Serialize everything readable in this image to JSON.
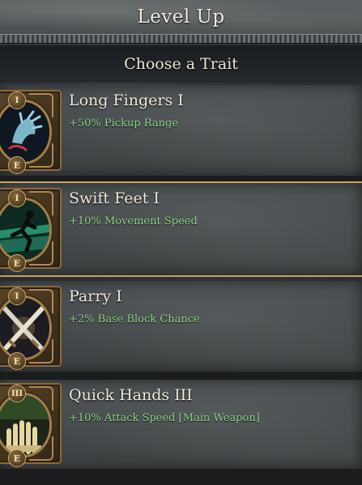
{
  "header": {
    "title": "Level Up"
  },
  "sub_header": {
    "title": "Choose a Trait"
  },
  "traits": [
    {
      "name": "Long Fingers I",
      "effect": "+50% Pickup Range",
      "rank": "I",
      "key": "E",
      "icon": "grabbing-hand-icon",
      "selected": false
    },
    {
      "name": "Swift Feet I",
      "effect": "+10% Movement Speed",
      "rank": "I",
      "key": "E",
      "icon": "running-figure-icon",
      "selected": true
    },
    {
      "name": "Parry I",
      "effect": "+2% Base Block Chance",
      "rank": "I",
      "key": "E",
      "icon": "crossed-swords-icon",
      "selected": false
    },
    {
      "name": "Quick Hands III",
      "effect": "+10% Attack Speed [Main Weapon]",
      "rank": "III",
      "key": "E",
      "icon": "open-hand-icon",
      "selected": false
    }
  ],
  "colors": {
    "effect_text": "#8fd48a",
    "gold_frame": "#c9a25a",
    "title_text": "#f0ead8"
  }
}
